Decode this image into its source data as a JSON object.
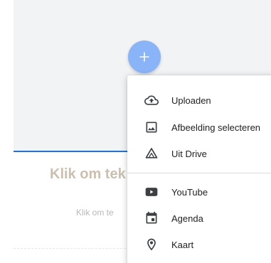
{
  "editor": {
    "heading": "Klik om tek",
    "subtext": "Klik om te"
  },
  "fab": {
    "icon": "plus-icon",
    "color": "#8ab4f8"
  },
  "menu": {
    "items": [
      {
        "label": "Uploaden",
        "icon": "cloud-upload-icon"
      },
      {
        "label": "Afbeelding selecteren",
        "icon": "image-icon"
      },
      {
        "label": "Uit Drive",
        "icon": "drive-icon"
      },
      {
        "label": "YouTube",
        "icon": "youtube-icon"
      },
      {
        "label": "Agenda",
        "icon": "calendar-icon"
      },
      {
        "label": "Kaart",
        "icon": "map-pin-icon"
      }
    ]
  },
  "colors": {
    "accent": "#1a73e8",
    "icon": "#3c4043"
  }
}
